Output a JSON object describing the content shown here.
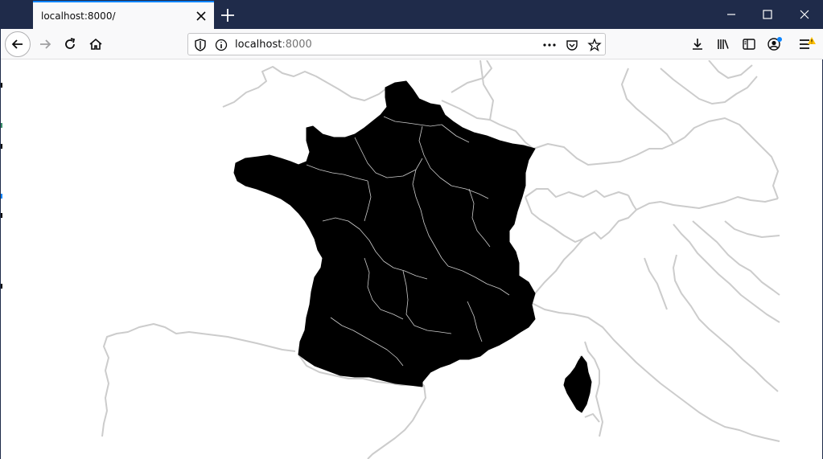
{
  "browser": {
    "tab": {
      "title": "localhost:8000/"
    },
    "address_bar": {
      "host": "localhost",
      "port": ":8000"
    }
  },
  "icons": {
    "tab_close": "close-icon",
    "new_tab": "plus-icon",
    "back": "back-arrow-icon",
    "forward": "forward-arrow-icon",
    "reload": "reload-icon",
    "home": "home-icon",
    "tracking_protection": "shield-icon",
    "site_info": "info-icon",
    "page_actions": "more-icon",
    "pocket": "pocket-icon",
    "bookmark": "star-icon",
    "downloads": "download-icon",
    "library": "library-icon",
    "sidebar": "sidebar-icon",
    "account": "account-icon",
    "menu": "menu-icon"
  },
  "map": {
    "highlighted_country": "France",
    "fill_color": "#000000",
    "border_color": "#cccccc",
    "background": "#ffffff"
  }
}
